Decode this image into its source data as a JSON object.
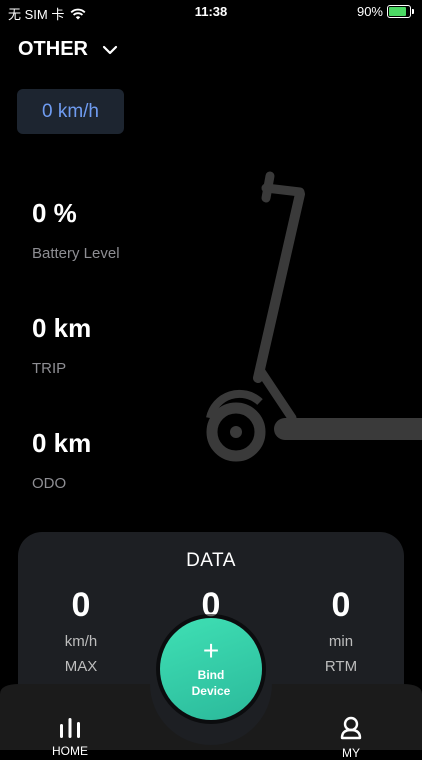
{
  "status_bar": {
    "carrier": "无 SIM 卡",
    "time": "11:38",
    "battery_percent_text": "90%",
    "battery_fraction": 0.9
  },
  "header": {
    "device_name": "OTHER"
  },
  "speed_chip": {
    "text": "0 km/h"
  },
  "stats": [
    {
      "value": "0 %",
      "label": "Battery Level"
    },
    {
      "value": "0 km",
      "label": "TRIP"
    },
    {
      "value": "0 km",
      "label": "ODO"
    }
  ],
  "data_card": {
    "title": "DATA",
    "items": [
      {
        "value": "0",
        "unit": "km/h",
        "label": "MAX"
      },
      {
        "value": "0",
        "unit": "",
        "label": ""
      },
      {
        "value": "0",
        "unit": "min",
        "label": "RTM"
      }
    ]
  },
  "bind_button": {
    "line1": "Bind",
    "line2": "Device"
  },
  "tabs": [
    {
      "label": "HOME",
      "icon": "bar-chart-icon"
    },
    {
      "label": "MY",
      "icon": "user-icon"
    }
  ],
  "colors": {
    "accent": "#3fd6ae",
    "speed_text": "#6f9cf1",
    "card_bg": "#1d1f23"
  }
}
